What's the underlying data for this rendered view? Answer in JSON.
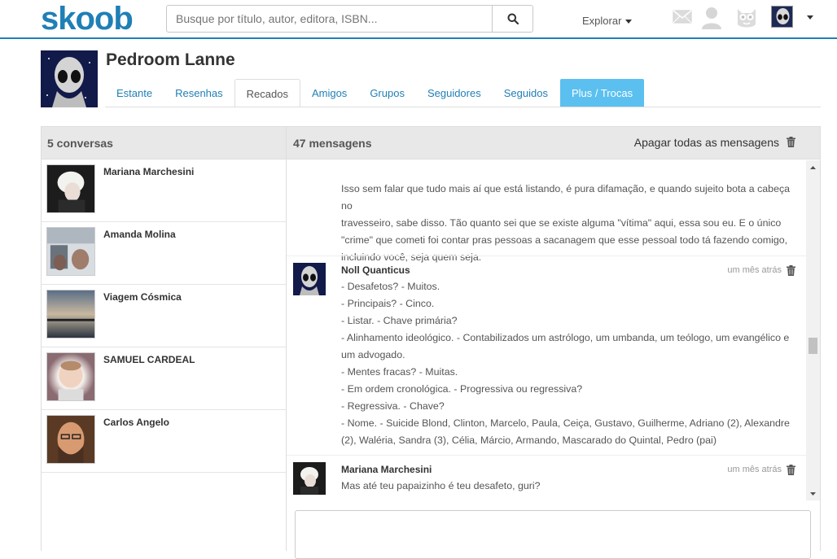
{
  "header": {
    "logo": "skoob",
    "search_placeholder": "Busque por título, autor, editora, ISBN...",
    "explore_label": "Explorar"
  },
  "profile": {
    "name": "Pedroom Lanne",
    "tabs": [
      "Estante",
      "Resenhas",
      "Recados",
      "Amigos",
      "Grupos",
      "Seguidores",
      "Seguidos",
      "Plus / Trocas"
    ],
    "active_tab": "Recados"
  },
  "conversations": {
    "title": "5 conversas",
    "items": [
      {
        "name": "Mariana Marchesini"
      },
      {
        "name": "Amanda Molina"
      },
      {
        "name": "Viagem Cósmica"
      },
      {
        "name": "SAMUEL CARDEAL"
      },
      {
        "name": "Carlos Angelo"
      }
    ]
  },
  "messages": {
    "title": "47 mensagens",
    "delete_all": "Apagar todas as mensagens",
    "continued_text": [
      "Isso sem falar que tudo mais aí que está listando, é pura difamação, e quando sujeito bota a cabeça no",
      "travesseiro, sabe disso. Tão quanto sei que se existe alguma \"vítima\" aqui, essa sou eu. E o único",
      "\"crime\" que cometi foi contar pras pessoas a sacanagem que esse pessoal todo tá fazendo comigo,",
      "incluindo você, seja quem seja."
    ],
    "items": [
      {
        "author": "Noll Quanticus",
        "time": "um mês atrás",
        "lines": [
          "- Desafetos? - Muitos.",
          "- Principais? - Cinco.",
          "- Listar. - Chave primária?",
          "- Alinhamento ideológico. - Contabilizados um astrólogo, um umbanda, um teólogo, um evangélico e",
          "um advogado.",
          "- Mentes fracas? - Muitas.",
          "- Em ordem cronológica. - Progressiva ou regressiva?",
          "- Regressiva. - Chave?",
          "- Nome. - Suicide Blond, Clinton, Marcelo, Paula, Ceiça, Gustavo, Guilherme, Adriano (2), Alexandre",
          "(2), Waléria, Sandra (3), Célia, Márcio, Armando, Mascarado do Quintal, Pedro (pai)"
        ]
      },
      {
        "author": "Mariana Marchesini",
        "time": "um mês atrás",
        "lines": [
          "Mas até teu papaizinho é teu desafeto, guri?"
        ]
      }
    ]
  },
  "colors": {
    "brand": "#1f7fb6",
    "plus_tab": "#5bc0f0",
    "panel_header": "#e8e8e8"
  }
}
